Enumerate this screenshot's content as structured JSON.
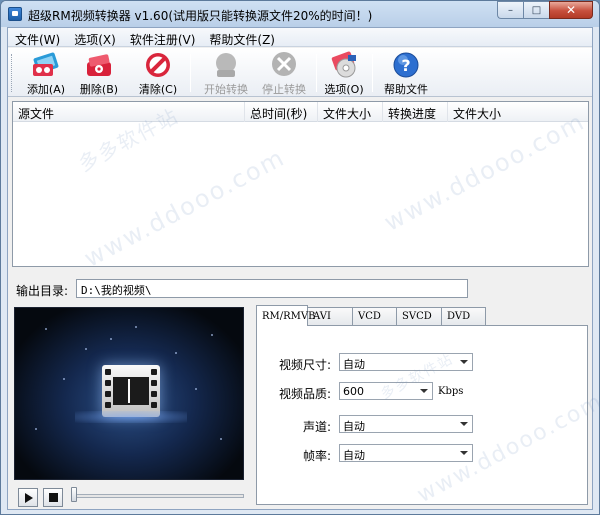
{
  "window": {
    "title": "超级RM视频转换器 v1.60(试用版只能转换源文件20%的时间！)",
    "min_glyph": "–",
    "max_glyph": "□",
    "close_glyph": "✕"
  },
  "menu": [
    {
      "label": "文件(W)"
    },
    {
      "label": "选项(X)"
    },
    {
      "label": "软件注册(V)"
    },
    {
      "label": "帮助文件(Z)"
    }
  ],
  "toolbar": {
    "add": {
      "label": "添加(A)",
      "icon": "add-video-icon",
      "enabled": true
    },
    "delete": {
      "label": "删除(B)",
      "icon": "delete-video-icon",
      "enabled": true
    },
    "clear": {
      "label": "清除(C)",
      "icon": "clear-icon",
      "enabled": true
    },
    "start": {
      "label": "开始转换",
      "icon": "start-convert-icon",
      "enabled": false
    },
    "stop": {
      "label": "停止转换",
      "icon": "stop-convert-icon",
      "enabled": false
    },
    "options": {
      "label": "选项(O)",
      "icon": "options-disc-icon",
      "enabled": true
    },
    "help": {
      "label": "帮助文件",
      "icon": "help-icon",
      "enabled": true
    }
  },
  "file_list": {
    "columns": [
      "源文件",
      "总时间(秒)",
      "文件大小",
      "转换进度",
      "文件大小"
    ],
    "rows": []
  },
  "output": {
    "label": "输出目录:",
    "path": "D:\\我的视频\\"
  },
  "player": {
    "play_icon": "play-icon",
    "stop_icon": "stop-icon",
    "position": 0
  },
  "format_tabs": [
    {
      "label": "RM/RMVB",
      "active": true
    },
    {
      "label": "AVI",
      "active": false
    },
    {
      "label": "VCD",
      "active": false
    },
    {
      "label": "SVCD",
      "active": false
    },
    {
      "label": "DVD",
      "active": false
    }
  ],
  "settings": {
    "video_size": {
      "label": "视频尺寸:",
      "value": "自动"
    },
    "video_quality": {
      "label": "视频品质:",
      "value": "600",
      "unit": "Kbps"
    },
    "audio_channel": {
      "label": "声道:",
      "value": "自动"
    },
    "frame_rate": {
      "label": "帧率:",
      "value": "自动"
    }
  },
  "watermarks": [
    "多多软件站",
    "www.ddooo.com"
  ],
  "colors": {
    "titlebar": "#c4d7ee",
    "accent_blue": "#2b62b8",
    "close_red": "#c7503d",
    "disabled_text": "#9a9a9a"
  }
}
